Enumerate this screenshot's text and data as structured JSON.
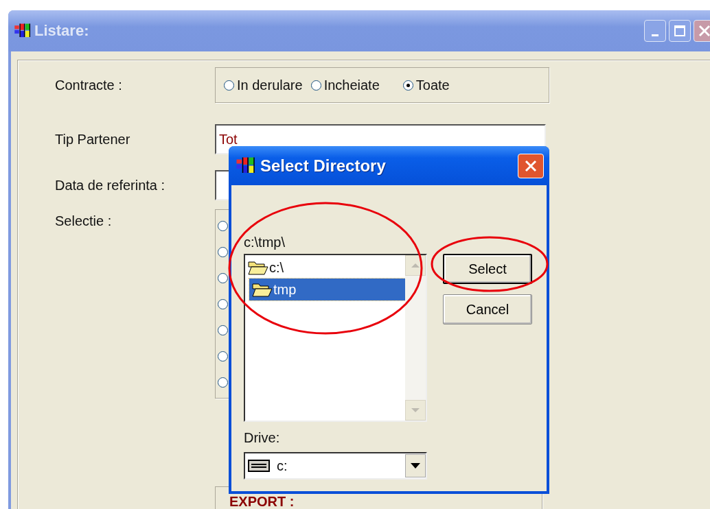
{
  "window": {
    "title": "Listare:"
  },
  "form": {
    "contracte": {
      "label": "Contracte :",
      "options": [
        {
          "label": "In derulare",
          "selected": false
        },
        {
          "label": "Incheiate",
          "selected": false
        },
        {
          "label": "Toate",
          "selected": true
        }
      ]
    },
    "tip_partener": {
      "label": "Tip Partener",
      "value": "Tot"
    },
    "data_referinta": {
      "label": "Data de referinta :"
    },
    "selectie": {
      "label": "Selectie :",
      "options": [
        {
          "selected": false
        },
        {
          "selected": false
        },
        {
          "selected": false
        },
        {
          "selected": false
        },
        {
          "selected": false
        },
        {
          "selected": false
        },
        {
          "selected": false
        }
      ]
    },
    "export": {
      "label": "EXPORT :"
    }
  },
  "dialog": {
    "title": "Select Directory",
    "path": "c:\\tmp\\",
    "folders": [
      {
        "name": "c:\\",
        "selected": false,
        "children": [
          {
            "name": "tmp",
            "selected": true
          }
        ]
      }
    ],
    "drive_label": "Drive:",
    "drive": "c:",
    "buttons": [
      {
        "label": "Select",
        "default": true
      },
      {
        "label": "Cancel",
        "default": false
      }
    ]
  }
}
